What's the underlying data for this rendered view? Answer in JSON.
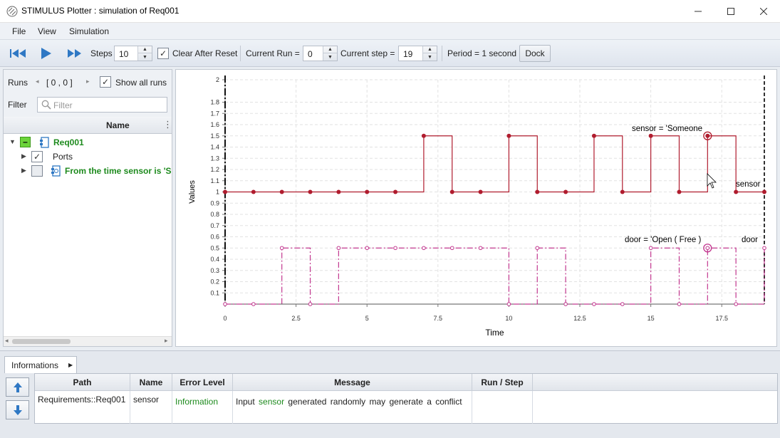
{
  "window": {
    "title": "STIMULUS Plotter : simulation of Req001"
  },
  "menu": {
    "file": "File",
    "view": "View",
    "simulation": "Simulation"
  },
  "toolbar": {
    "steps_label": "Steps",
    "steps_value": "10",
    "clear_after_reset": "Clear After Reset",
    "current_run_label": "Current Run =",
    "current_run_value": "0",
    "current_step_label": "Current step =",
    "current_step_value": "19",
    "period": "Period = 1 second",
    "dock": "Dock"
  },
  "left": {
    "runs_label": "Runs",
    "runs_range": "[ 0 , 0 ]",
    "show_all_runs": "Show all runs",
    "filter_label": "Filter",
    "filter_placeholder": "Filter",
    "column_name": "Name",
    "tree": {
      "req": "Req001",
      "ports": "Ports",
      "requirement": "From the time  sensor is  'S"
    }
  },
  "plot": {
    "annotations": {
      "sensor_label": "sensor = 'Someone",
      "sensor_right": "sensor",
      "door_label": "door = 'Open ( Free )",
      "door_right": "door"
    }
  },
  "chart_data": {
    "type": "line",
    "xlabel": "Time",
    "ylabel": "Values",
    "xlim": [
      0,
      19
    ],
    "ylim": [
      0,
      2
    ],
    "xticks": [
      0,
      2.5,
      5,
      7.5,
      10,
      12.5,
      15,
      17.5
    ],
    "yticks": [
      0.1,
      0.2,
      0.3,
      0.4,
      0.5,
      0.6,
      0.7,
      0.8,
      0.9,
      1,
      1.1,
      1.2,
      1.3,
      1.4,
      1.5,
      1.6,
      1.7,
      1.8,
      2
    ],
    "grid": true,
    "series": [
      {
        "color": "#b01c2e",
        "style": "step",
        "x": [
          0,
          1,
          2,
          3,
          4,
          5,
          6,
          7,
          8,
          9,
          10,
          11,
          12,
          13,
          14,
          15,
          16,
          17,
          18,
          19
        ],
        "values": [
          1,
          1,
          1,
          1,
          1,
          1,
          1,
          1.5,
          1,
          1,
          1.5,
          1,
          1,
          1.5,
          1,
          1.5,
          1,
          1.5,
          1,
          1
        ]
      },
      {
        "color": "#c2378f",
        "style": "step-dashdot",
        "x": [
          0,
          1,
          2,
          3,
          4,
          5,
          6,
          7,
          8,
          9,
          10,
          11,
          12,
          13,
          14,
          15,
          16,
          17,
          18,
          19
        ],
        "values": [
          0,
          0,
          0.5,
          0,
          0.5,
          0.5,
          0.5,
          0.5,
          0.5,
          0.5,
          0,
          0.5,
          0,
          0,
          0,
          0.5,
          0,
          0.5,
          0,
          0.5
        ]
      }
    ]
  },
  "info": {
    "tab": "Informations",
    "headers": {
      "path": "Path",
      "name": "Name",
      "error_level": "Error Level",
      "message": "Message",
      "run_step": "Run / Step"
    },
    "row": {
      "path": "Requirements::Req001",
      "name": "sensor",
      "error_level": "Information",
      "message_prefix": "Input",
      "message_var": "sensor",
      "message_suffix": "generated randomly may generate a conflict"
    }
  }
}
